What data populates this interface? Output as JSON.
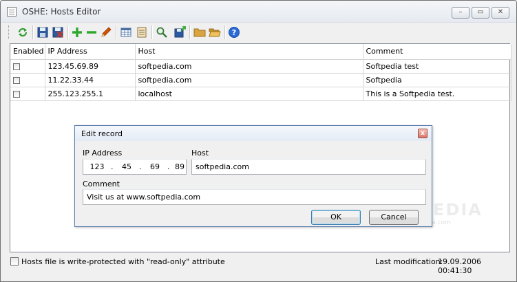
{
  "window": {
    "title": "OSHE: Hosts Editor",
    "controls": {
      "minimize": "–",
      "maximize": "▭",
      "close": "✕"
    }
  },
  "toolbar": {
    "buttons": [
      {
        "name": "refresh-icon",
        "color": "#2e9e2e"
      },
      {
        "name": "save-icon",
        "color": "#2c5aa0"
      },
      {
        "name": "delete-file-icon",
        "color": "#c0392b"
      },
      {
        "name": "add-icon",
        "color": "#2fa82f"
      },
      {
        "name": "remove-icon",
        "color": "#2fa82f"
      },
      {
        "name": "edit-pencil-icon",
        "color": "#d35400"
      },
      {
        "name": "table-view-icon",
        "color": "#4a6fa5"
      },
      {
        "name": "notes-icon",
        "color": "#8a6d3b"
      },
      {
        "name": "search-icon",
        "color": "#3a7a3a"
      },
      {
        "name": "export-icon",
        "color": "#2c5aa0"
      },
      {
        "name": "folder-icon",
        "color": "#d9a441"
      },
      {
        "name": "open-folder-icon",
        "color": "#d9a441"
      },
      {
        "name": "help-icon",
        "color": "#2a6ad8"
      }
    ]
  },
  "table": {
    "columns": [
      "Enabled",
      "IP Address",
      "Host",
      "Comment"
    ],
    "rows": [
      {
        "enabled": false,
        "ip": "123.45.69.89",
        "host": "softpedia.com",
        "comment": "Softpedia test"
      },
      {
        "enabled": false,
        "ip": "11.22.33.44",
        "host": "softpedia.com",
        "comment": "Softpedia"
      },
      {
        "enabled": false,
        "ip": "255.123.255.1",
        "host": "localhost",
        "comment": "This is a Softpedia test."
      }
    ]
  },
  "dialog": {
    "title": "Edit record",
    "ip_label": "IP Address",
    "ip_octets": [
      "123",
      "45",
      "69",
      "89"
    ],
    "ip_separator": ".",
    "host_label": "Host",
    "host_value": "softpedia.com",
    "comment_label": "Comment",
    "comment_value": "Visit us at www.softpedia.com",
    "ok_label": "OK",
    "cancel_label": "Cancel",
    "close_glyph": "x"
  },
  "status": {
    "readonly_label": "Hosts file is write-protected with \"read-only\" attribute",
    "readonly_checked": false,
    "last_mod_label": "Last modification:",
    "last_mod_value": "19.09.2006 00:41:30"
  },
  "watermark": {
    "text": "SOFTPEDIA",
    "url": "www.softpedia.com"
  }
}
